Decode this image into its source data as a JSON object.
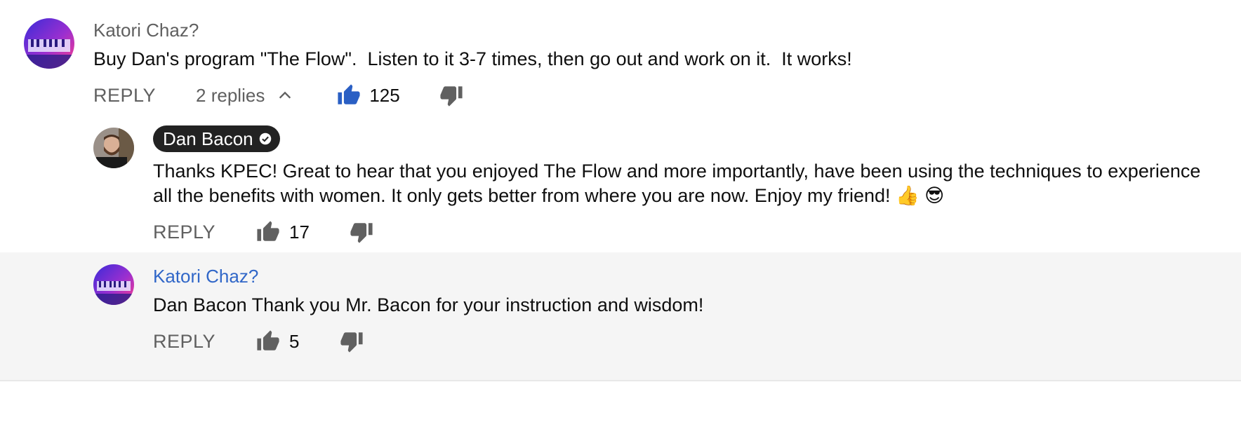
{
  "top_comment": {
    "author": "Katori Chaz?",
    "text": "Buy Dan's program \"The Flow\".  Listen to it 3-7 times, then go out and work on it.  It works!",
    "reply_label": "REPLY",
    "replies_label": "2 replies",
    "like_count": "125",
    "liked": true
  },
  "replies": [
    {
      "author": "Dan Bacon",
      "is_owner": true,
      "text_line1": "Thanks KPEC! Great to hear that you enjoyed The Flow and more importantly, have been using the techniques to experience",
      "text_line2": "all the benefits with women. It only gets better from where you are now. Enjoy my friend! 👍 😎",
      "reply_label": "REPLY",
      "like_count": "17"
    },
    {
      "author": "Katori Chaz?",
      "highlighted": true,
      "text": "Dan Bacon Thank you Mr. Bacon for your instruction and wisdom!",
      "reply_label": "REPLY",
      "like_count": "5"
    }
  ],
  "colors": {
    "like_active": "#2a5fc4",
    "icon_gray": "#606060",
    "highlight_bg": "#f5f5f5",
    "link_blue": "#3167c8",
    "owner_badge_bg": "#222222"
  }
}
